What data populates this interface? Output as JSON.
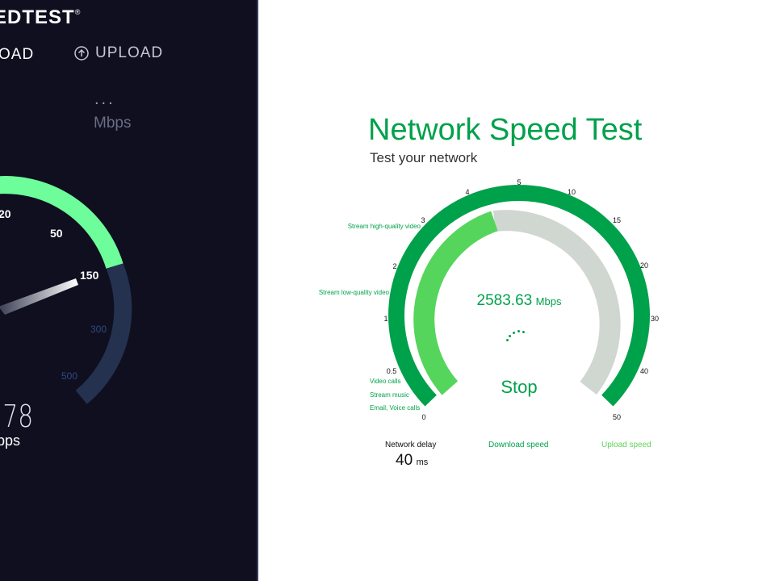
{
  "left_app": {
    "logo": "EDTEST",
    "logo_mark": "®",
    "tabs": {
      "download": "OAD",
      "upload": "UPLOAD"
    },
    "status_dots": "...",
    "status_unit": "Mbps",
    "gauge_ticks": [
      "20",
      "50",
      "150",
      "300",
      "500"
    ],
    "reading": ".78",
    "reading_unit": "bps",
    "colors": {
      "background": "#0f0f20",
      "progress": "#6dfd9a",
      "track": "#24324f"
    },
    "upload_icon": "arrow-up-circle-icon"
  },
  "right_app": {
    "title": "Network Speed Test",
    "subtitle": "Test your network",
    "gauge": {
      "ticks": [
        "0",
        "0.5",
        "1",
        "2",
        "3",
        "4",
        "5",
        "10",
        "15",
        "20",
        "30",
        "40",
        "50"
      ],
      "annotations": [
        "Stream high-quality video",
        "Stream low-quality video",
        "Video calls",
        "Stream music",
        "Email, Voice calls"
      ],
      "progress_fraction": 0.36,
      "colors": {
        "outer": "#00a14b",
        "progress": "#55d55c",
        "remaining": "#d0d6d0"
      }
    },
    "current_speed": {
      "value": "2583.63",
      "unit": "Mbps"
    },
    "stop_label": "Stop",
    "metrics": {
      "network_delay": {
        "label": "Network delay",
        "value": "40",
        "unit": "ms"
      },
      "download_speed": {
        "label": "Download speed"
      },
      "upload_speed": {
        "label": "Upload speed"
      }
    }
  }
}
